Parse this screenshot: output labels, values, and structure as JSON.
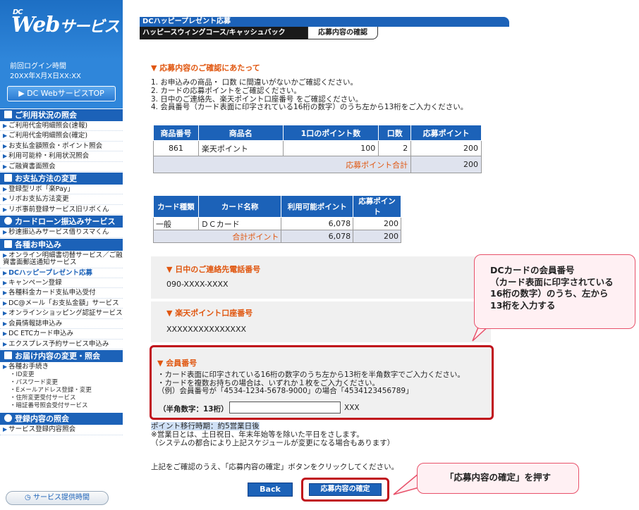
{
  "sidebar": {
    "logo_dc": "DC",
    "logo_text": "Web",
    "logo_kana": "サービス",
    "last_login_label": "前回ログイン時間",
    "last_login_value": "20XX年X月X日XX:XX",
    "top_button": "▶ DC WebサービスTOP",
    "sections": [
      {
        "title": "ご利用状況の照会",
        "items": [
          "ご利用代金明細照会(速報)",
          "ご利用代金明細照会(確定)",
          "お支払金額照会・ポイント照会",
          "利用可能枠・利用状況照会",
          "ご融資書面照会"
        ]
      },
      {
        "title": "お支払方法の変更",
        "items": [
          "登録型リボ「楽Pay」",
          "リボお支払方法変更",
          "リボ事前登録サービス旧リボくん"
        ]
      },
      {
        "title": "カードローン振込みサービス",
        "items": [
          "秒速振込みサービス借りスマくん"
        ]
      },
      {
        "title": "各種お申込み",
        "items": [
          "オンライン明細書切替サービス／ご融資書面郵送通知サービス",
          "DCハッピープレゼント応募",
          "キャンペーン登録",
          "各種料金カード支払申込受付",
          "DC@メール「お支払金額」サービス",
          "オンラインショッピング認証サービス",
          "会員情報誌申込み",
          "DC ETCカード申込み",
          "エクスプレス予約サービス申込み"
        ]
      },
      {
        "title": "お届け内容の変更・照会",
        "items": [
          "各種お手続き"
        ],
        "sub_items": [
          "・ID変更",
          "・パスワード変更",
          "・Eメールアドレス登録・変更",
          "・住所変更受付サービス",
          "・暗証番号照会受付サービス"
        ]
      },
      {
        "title": "登録内容の照会",
        "items": [
          "サービス登録内容照会"
        ]
      }
    ],
    "service_time": "サービス提供時間"
  },
  "header": {
    "title": "DCハッピープレゼント応募",
    "tab_course": "ハッピースウィングコース/キャッシュバック",
    "tab_confirm": "応募内容の確認"
  },
  "notice": {
    "heading": "▼ 応募内容のご確認にあたって",
    "lines": [
      "1. お申込みの商品・ 口数 に間違いがないかご確認ください。",
      "2. カードの応募ポイントをご確認ください。",
      "3. 日中のご連絡先、楽天ポイント口座番号 をご確認ください。",
      "4. 会員番号（カード表面に印字されている16桁の数字）のうち左から13桁をご入力ください。"
    ]
  },
  "product_table": {
    "headers": [
      "商品番号",
      "商品名",
      "1口のポイント数",
      "口数",
      "応募ポイント"
    ],
    "rows": [
      [
        "861",
        "楽天ポイント",
        "100",
        "2",
        "200"
      ]
    ],
    "total_label": "応募ポイント合計",
    "total_value": "200"
  },
  "card_table": {
    "headers": [
      "カード種類",
      "カード名称",
      "利用可能ポイント",
      "応募ポイント"
    ],
    "rows": [
      [
        "一般",
        "ＤＣカード",
        "6,078",
        "200"
      ]
    ],
    "total_label": "合計ポイント",
    "total_available": "6,078",
    "total_applied": "200"
  },
  "phone": {
    "heading": "▼ 日中のご連絡先電話番号",
    "value": "090-XXXX-XXXX"
  },
  "rakuten": {
    "heading": "▼ 楽天ポイント口座番号",
    "value": "XXXXXXXXXXXXXXX"
  },
  "member": {
    "heading": "▼ 会員番号",
    "lines": [
      "・カード表面に印字されている16桁の数字のうち左から13桁を半角数字でご入力ください。",
      "・カードを複数お持ちの場合は、いずれか１枚をご入力ください。",
      "（例）会員番号が「4534-1234-5678-9000」の場合「4534123456789」"
    ],
    "input_label": "（半角数字：13桁）",
    "input_suffix": "XXX"
  },
  "transfer": {
    "title": "ポイント移行時期：約5営業日後",
    "lines": [
      "※営業日とは、土日祝日、年末年始等を除いた平日をさします。",
      "（システムの都合により上記スケジュールが変更になる場合もあります）"
    ]
  },
  "confirm_text": "上記をご確認のうえ、「応募内容の確定」ボタンをクリックしてください。",
  "buttons": {
    "back": "Back",
    "confirm": "応募内容の確定"
  },
  "callouts": {
    "member_note": [
      "DCカードの会員番号",
      "（カード表面に印字されている",
      "16桁の数字）のうち、左から",
      "13桁を入力する"
    ],
    "press_confirm": "「応募内容の確定」を押す"
  },
  "colors": {
    "brand_blue": "#1c62b8",
    "accent_orange": "#e0560f",
    "highlight_red": "#c0111b",
    "callout_pink": "#fff0f3"
  }
}
